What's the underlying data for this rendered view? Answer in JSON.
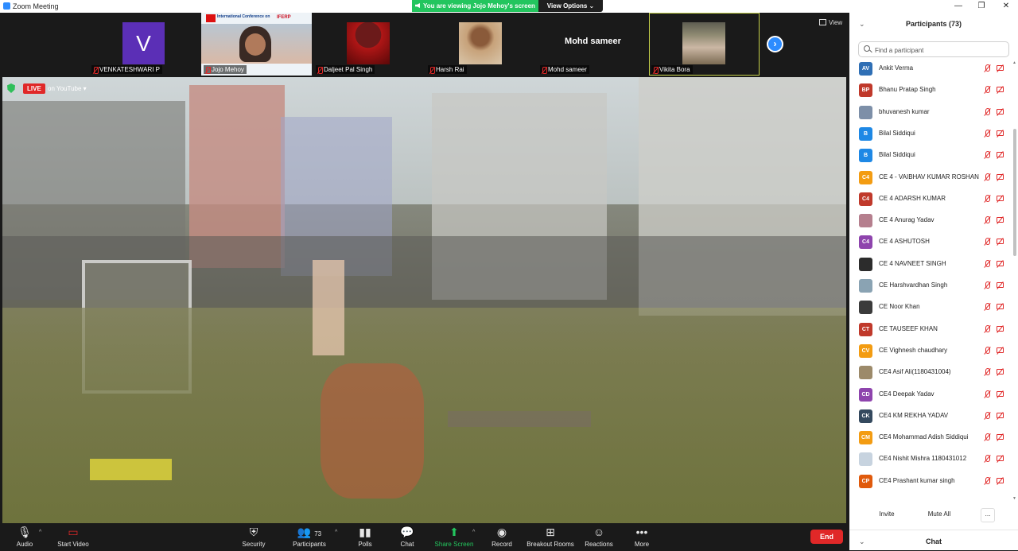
{
  "window": {
    "title": "Zoom Meeting",
    "banner": "You are viewing Jojo Mehoy's screen",
    "view_options": "View Options",
    "controls": [
      "—",
      "❐",
      "✕"
    ]
  },
  "thumbnails": [
    {
      "name": "VENKATESHWARI P",
      "avatar_letter": "V"
    },
    {
      "name": "Jojo Mehoy",
      "poster_title": "International Conference on",
      "poster_logo": "IFERP"
    },
    {
      "name": "Daljeet Pal Singh"
    },
    {
      "name": "Harsh Rai"
    },
    {
      "name": "Mohd sameer",
      "card_name": "Mohd sameer"
    },
    {
      "name": "Vikita Bora"
    }
  ],
  "view_button": "View",
  "video_overlay": {
    "live": "LIVE",
    "platform": "on YouTube ▾"
  },
  "toolbar": {
    "audio": "Audio",
    "start_video": "Start Video",
    "security": "Security",
    "participants": "Participants",
    "participant_count": "73",
    "polls": "Polls",
    "chat": "Chat",
    "share_screen": "Share Screen",
    "record": "Record",
    "breakout_rooms": "Breakout Rooms",
    "reactions": "Reactions",
    "more": "More",
    "end": "End"
  },
  "panel": {
    "title": "Participants (73)",
    "search_placeholder": "Find a participant",
    "participants": [
      {
        "initials": "AV",
        "name": "Ankit Verma",
        "color": "#2f6fb5"
      },
      {
        "initials": "BP",
        "name": "Bhanu Pratap Singh",
        "color": "#c0392b"
      },
      {
        "initials": "",
        "name": "bhuvanesh kumar",
        "color": "#7d8fa8"
      },
      {
        "initials": "B",
        "name": "Bilal Siddiqui",
        "color": "#1e88e5"
      },
      {
        "initials": "B",
        "name": "Bilal Siddiqui",
        "color": "#1e88e5"
      },
      {
        "initials": "C4",
        "name": "CE 4 - VAIBHAV KUMAR ROSHAN",
        "color": "#f39c12"
      },
      {
        "initials": "C4",
        "name": "CE 4 ADARSH KUMAR",
        "color": "#c0392b"
      },
      {
        "initials": "",
        "name": "CE 4 Anurag Yadav",
        "color": "#b57f8e"
      },
      {
        "initials": "C4",
        "name": "CE 4 ASHUTOSH",
        "color": "#8e44ad"
      },
      {
        "initials": "",
        "name": "CE 4 NAVNEET SINGH",
        "color": "#2c2c2c"
      },
      {
        "initials": "",
        "name": "CE Harshvardhan Singh",
        "color": "#8aa3b3"
      },
      {
        "initials": "",
        "name": "CE Noor Khan",
        "color": "#3b3b3b"
      },
      {
        "initials": "CT",
        "name": "CE TAUSEEF KHAN",
        "color": "#c0392b"
      },
      {
        "initials": "CV",
        "name": "CE Vighnesh chaudhary",
        "color": "#f39c12"
      },
      {
        "initials": "",
        "name": "CE4 Asif Ali(1180431004)",
        "color": "#9c8a6a"
      },
      {
        "initials": "CD",
        "name": "CE4 Deepak Yadav",
        "color": "#8e44ad"
      },
      {
        "initials": "CK",
        "name": "CE4 KM REKHA YADAV",
        "color": "#34495e"
      },
      {
        "initials": "CM",
        "name": "CE4 Mohammad Adish Siddiqui",
        "color": "#f39c12"
      },
      {
        "initials": "",
        "name": "CE4 Nishit Mishra 1180431012",
        "color": "#c7d3df"
      },
      {
        "initials": "CP",
        "name": "CE4 Prashant kumar singh",
        "color": "#e05a0c"
      }
    ],
    "invite": "Invite",
    "mute_all": "Mute All",
    "more": "...",
    "chat": "Chat"
  }
}
